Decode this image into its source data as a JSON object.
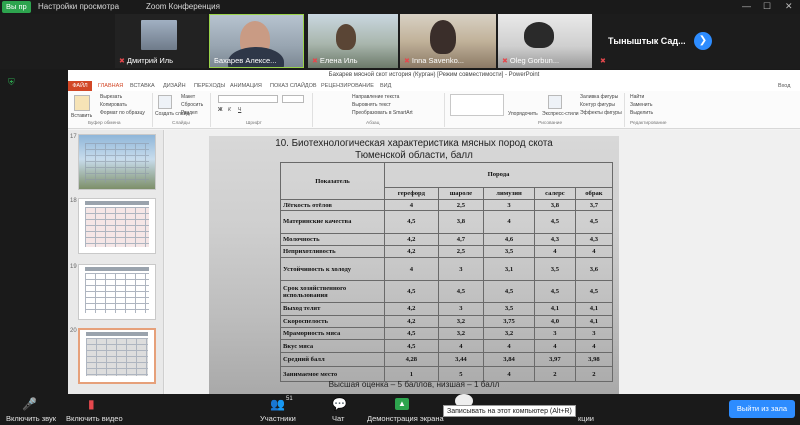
{
  "zoom": {
    "share_chip": "Вы пр",
    "view_menu": "Настройки просмотра",
    "conference_title": "Zoom Конференция",
    "view_label": "Вид",
    "participants": [
      {
        "name": "Дмитрий Иль"
      },
      {
        "name": "Бахарев Алексе..."
      },
      {
        "name": "Елена Иль"
      },
      {
        "name": "Inna Savenko..."
      },
      {
        "name": "Oleg Gorbun..."
      },
      {
        "name": "Тыныштык Сад..."
      }
    ]
  },
  "powerpoint": {
    "title": "Бахарев мясной скот история (Курган) [Режим совместимости] - PowerPoint",
    "sign_in": "Вход",
    "tabs": [
      "ФАЙЛ",
      "ГЛАВНАЯ",
      "ВСТАВКА",
      "ДИЗАЙН",
      "ПЕРЕХОДЫ",
      "АНИМАЦИЯ",
      "ПОКАЗ СЛАЙДОВ",
      "РЕЦЕНЗИРОВАНИЕ",
      "ВИД"
    ],
    "ribbon": {
      "paste": "Вставить",
      "cut": "Вырезать",
      "copy": "Копировать",
      "format_painter": "Формат по образцу",
      "clipboard": "Буфер обмена",
      "new_slide": "Создать слайд",
      "layout": "Макет",
      "reset": "Сбросить",
      "section": "Раздел",
      "slides": "Слайды",
      "font": "Шрифт",
      "text_direction": "Направление текста",
      "align_text": "Выровнять текст",
      "smartart": "Преобразовать в SmartArt",
      "paragraph": "Абзац",
      "arrange": "Упорядочить",
      "quick_styles": "Экспресс-стили",
      "shape_fill": "Заливка фигуры",
      "shape_outline": "Контур фигуры",
      "shape_effects": "Эффекты фигуры",
      "drawing": "Рисование",
      "find": "Найти",
      "replace": "Заменить",
      "select": "Выделить",
      "editing": "Редактирование"
    },
    "thumbnails": [
      "17",
      "18",
      "19",
      "20"
    ]
  },
  "slide": {
    "title_line1": "10. Биотехнологическая характеристика мясных пород скота",
    "title_line2": "Тюменской области, балл",
    "head_indicator": "Показатель",
    "head_breed": "Порода",
    "breeds": [
      "герефорд",
      "шароле",
      "лимузин",
      "салерс",
      "обрак"
    ],
    "rows": [
      {
        "label": "Лёгкость отёлов",
        "values": [
          "4",
          "2,5",
          "3",
          "3,8",
          "3,7"
        ]
      },
      {
        "label": "Материнские качества",
        "values": [
          "4,5",
          "3,8",
          "4",
          "4,5",
          "4,5"
        ]
      },
      {
        "label": "Молочность",
        "values": [
          "4,2",
          "4,7",
          "4,6",
          "4,3",
          "4,3"
        ]
      },
      {
        "label": "Неприхотливость",
        "values": [
          "4,2",
          "2,5",
          "3,5",
          "4",
          "4"
        ]
      },
      {
        "label": "Устойчивость к холоду",
        "values": [
          "4",
          "3",
          "3,1",
          "3,5",
          "3,6"
        ]
      },
      {
        "label": "Срок хозяйственного использования",
        "values": [
          "4,5",
          "4,5",
          "4,5",
          "4,5",
          "4,5"
        ]
      },
      {
        "label": "Выход телят",
        "values": [
          "4,2",
          "3",
          "3,5",
          "4,1",
          "4,1"
        ]
      },
      {
        "label": "Скороспелость",
        "values": [
          "4,2",
          "3,2",
          "3,75",
          "4,0",
          "4,1"
        ]
      },
      {
        "label": "Мраморность мяса",
        "values": [
          "4,5",
          "3,2",
          "3,2",
          "3",
          "3"
        ]
      },
      {
        "label": "Вкус мяса",
        "values": [
          "4,5",
          "4",
          "4",
          "4",
          "4"
        ]
      },
      {
        "label": "Средний балл",
        "values": [
          "4,28",
          "3,44",
          "3,84",
          "3,97",
          "3,98"
        ]
      },
      {
        "label": "Занимаемое место",
        "values": [
          "1",
          "5",
          "4",
          "2",
          "2"
        ]
      }
    ],
    "footnote": "Высшая оценка – 5 баллов, низшая – 1 балл"
  },
  "bottom": {
    "audio": "Включить звук",
    "video": "Включить видео",
    "participants": "Участники",
    "participants_count": "51",
    "chat": "Чат",
    "share": "Демонстрация экрана",
    "record_tip": "Записывать на этот компьютер (Alt+R)",
    "reactions": "кции",
    "leave": "Выйти из зала"
  }
}
